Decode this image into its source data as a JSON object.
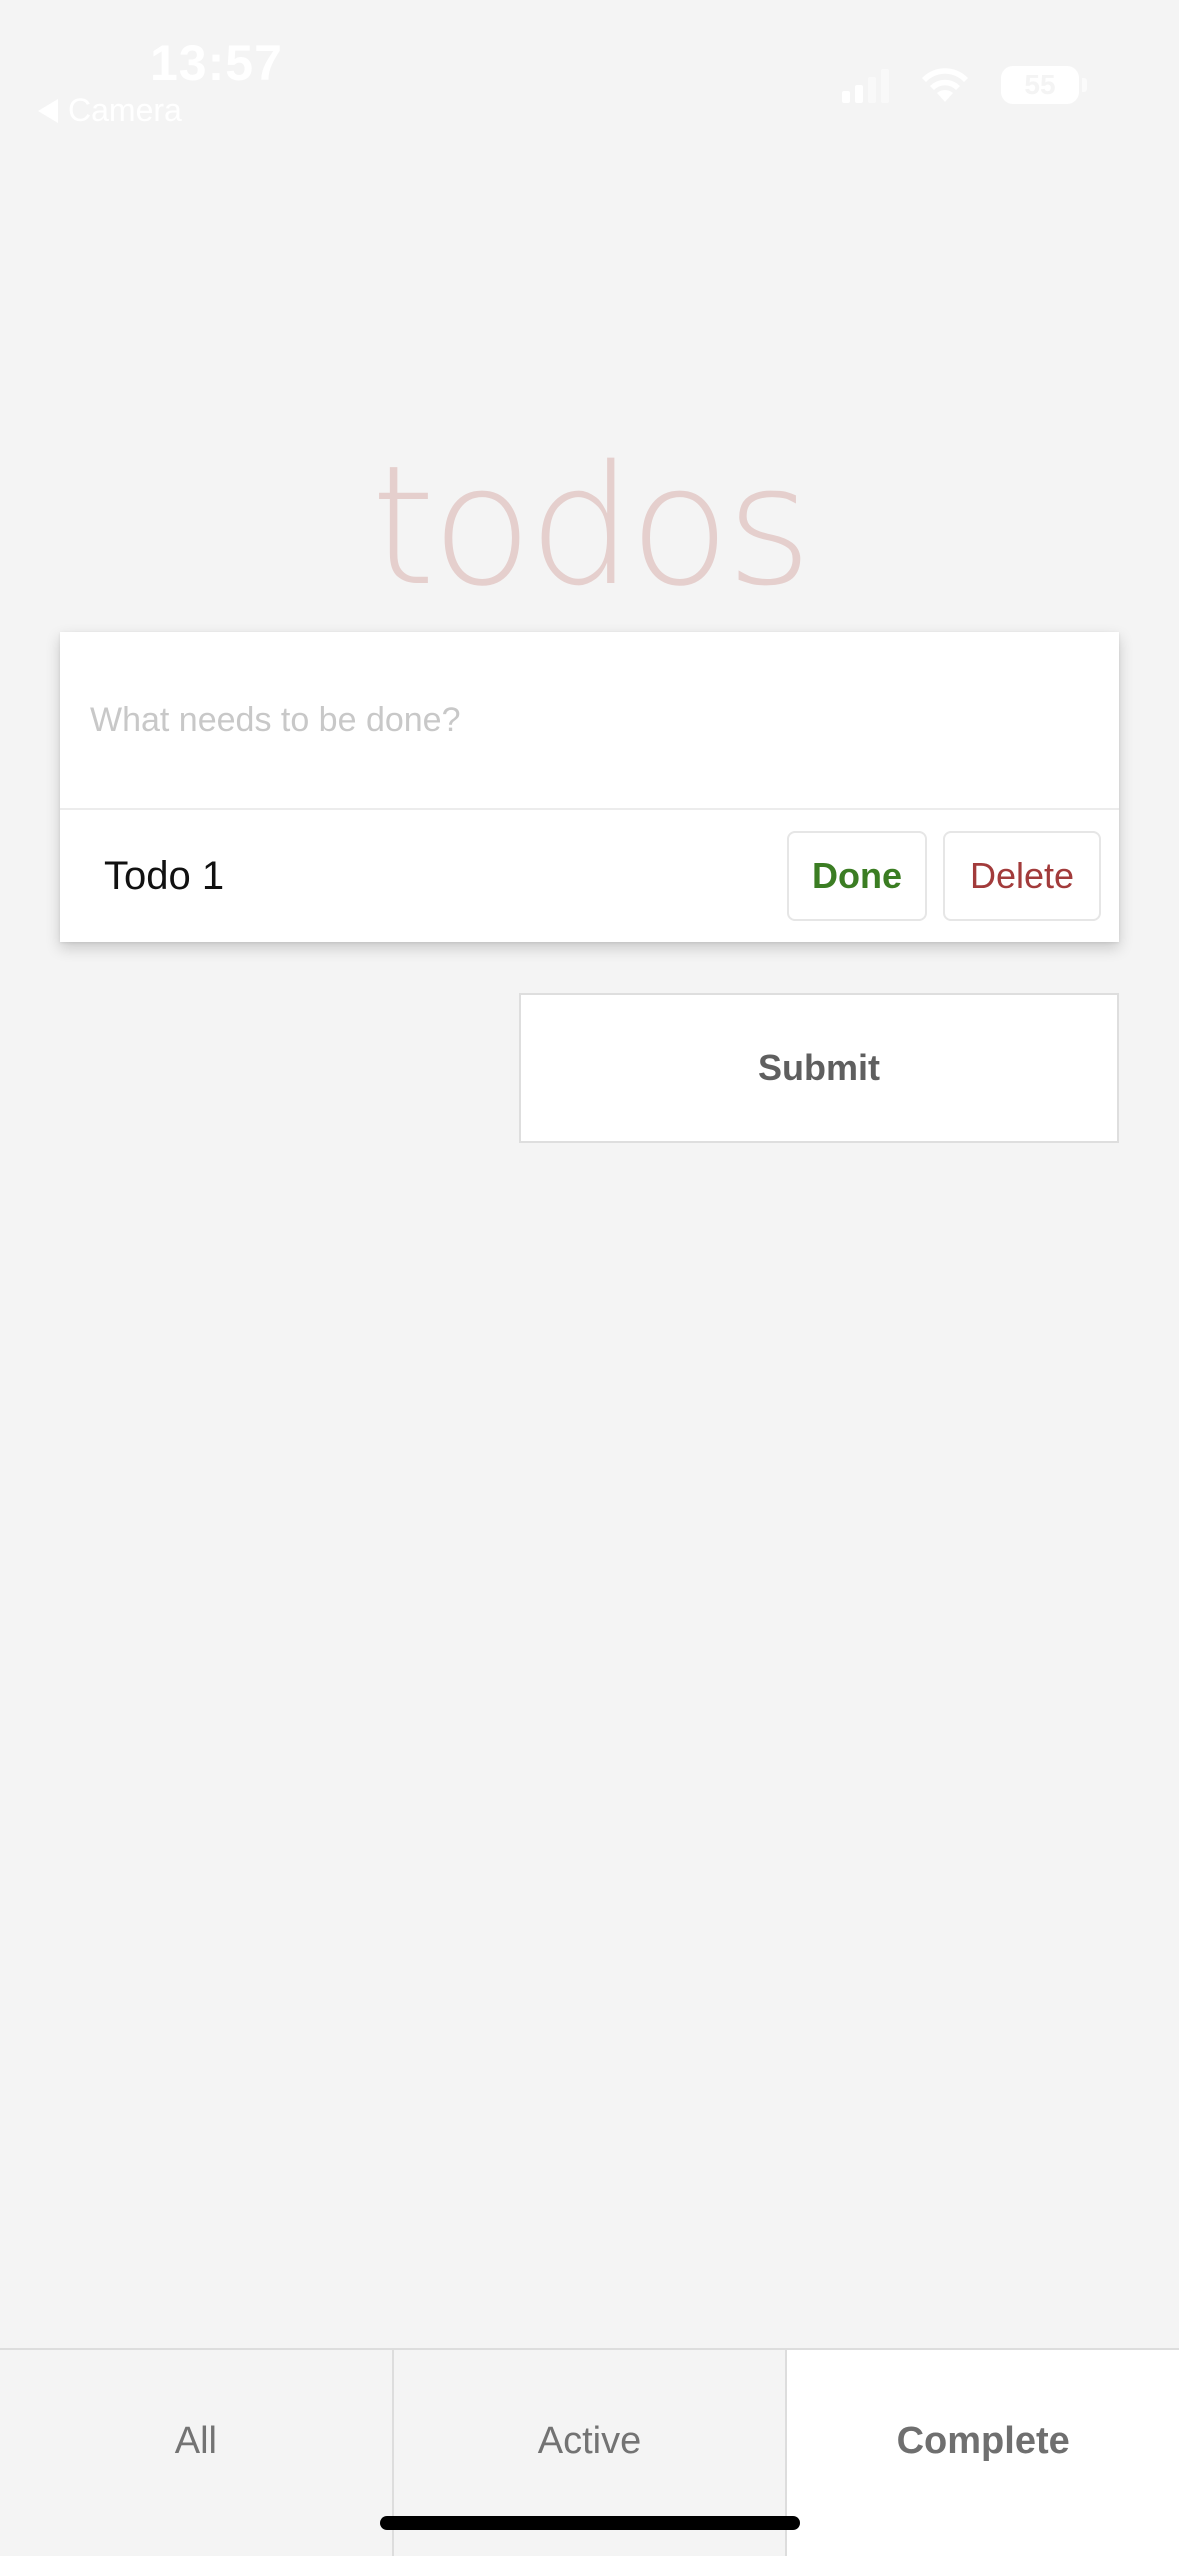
{
  "status_bar": {
    "time": "13:57",
    "back_label": "Camera",
    "battery": "55"
  },
  "app": {
    "title": "todos"
  },
  "new_todo": {
    "placeholder": "What needs to be done?",
    "value": ""
  },
  "todos": [
    {
      "label": "Todo 1",
      "done_label": "Done",
      "delete_label": "Delete"
    }
  ],
  "submit_label": "Submit",
  "tabs": [
    {
      "label": "All",
      "selected": false
    },
    {
      "label": "Active",
      "selected": false
    },
    {
      "label": "Complete",
      "selected": true
    }
  ],
  "colors": {
    "background": "#f4f4f4",
    "title": "#e5cfcd",
    "done": "#3b7d23",
    "delete": "#a23b3b"
  }
}
